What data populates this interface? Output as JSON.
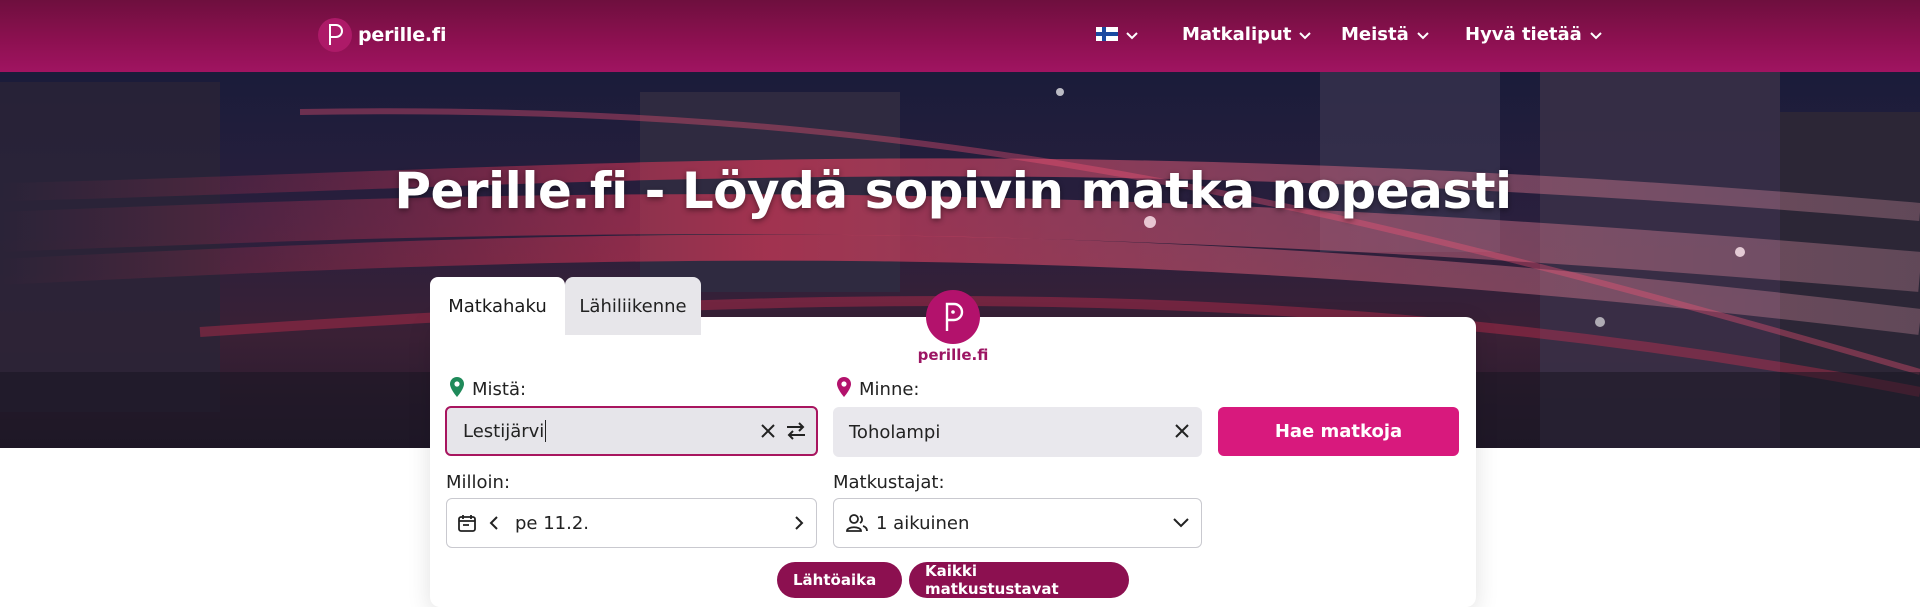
{
  "header": {
    "logo_text": "perille.fi",
    "nav": [
      {
        "label": "Matkaliput"
      },
      {
        "label": "Meistä"
      },
      {
        "label": "Hyvä tietää"
      }
    ]
  },
  "hero": {
    "title": "Perille.fi - Löydä sopivin matka nopeasti"
  },
  "search": {
    "tabs": [
      {
        "label": "Matkahaku",
        "active": true
      },
      {
        "label": "Lähiliikenne",
        "active": false
      }
    ],
    "brand_text": "perille.fi",
    "from": {
      "label": "Mistä:",
      "value": "Lestijärvi"
    },
    "to": {
      "label": "Minne:",
      "value": "Toholampi"
    },
    "search_button": "Hae matkoja",
    "when": {
      "label": "Milloin:",
      "value": "pe 11.2."
    },
    "travellers": {
      "label": "Matkustajat:",
      "value": "1 aikuinen"
    },
    "filters": [
      "Lähtöaika",
      "Kaikki matkustustavat"
    ]
  },
  "colors": {
    "brand": "#a01461",
    "accent": "#d8197d",
    "pin_from": "#1f8a5a",
    "pin_to": "#b3126c"
  },
  "icons": [
    "finland-flag-icon",
    "chevron-down-icon",
    "location-pin-icon",
    "clear-icon",
    "swap-icon",
    "calendar-icon",
    "chevron-left-icon",
    "chevron-right-icon",
    "travellers-icon"
  ]
}
